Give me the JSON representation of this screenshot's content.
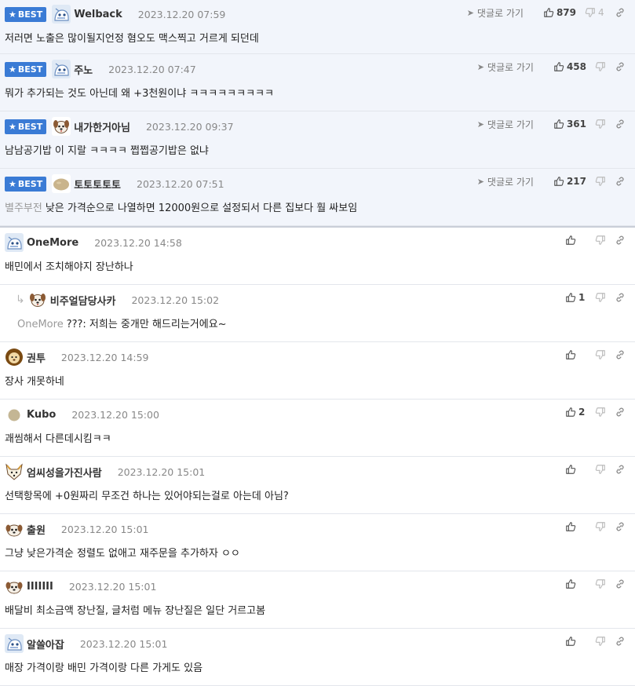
{
  "colors": {
    "best_badge": "#3a7bd5",
    "best_bg": "#f2f5fb",
    "border": "#e3e6ec"
  },
  "labels": {
    "best": "BEST",
    "goto": "댓글로 가기"
  },
  "best_comments": [
    {
      "author": "Welback",
      "time": "2023.12.20 07:59",
      "text": "저러면 노출은 많이될지언정 혐오도 맥스찍고 거르게 되던데",
      "likes": "879",
      "dislikes": "4",
      "avatar": "robot-avatar"
    },
    {
      "author": "주노",
      "time": "2023.12.20 07:47",
      "text": "뭐가 추가되는 것도 아닌데 왜 +3천원이냐 ㅋㅋㅋㅋㅋㅋㅋㅋㅋ",
      "likes": "458",
      "dislikes": "",
      "avatar": "robot-avatar"
    },
    {
      "author": "내가한거아님",
      "time": "2023.12.20 09:37",
      "text": "남남공기밥 이 지랄 ㅋㅋㅋㅋ 쩝쩝공기밥은 없냐",
      "likes": "361",
      "dislikes": "",
      "avatar": "dog-avatar"
    },
    {
      "author": "토토토토토",
      "time": "2023.12.20 07:51",
      "text": "낮은 가격순으로 나열하면 12000원으로 설정되서 다른 집보다 훨 싸보임",
      "mention": "별주부전",
      "likes": "217",
      "dislikes": "",
      "avatar": "potato-avatar"
    }
  ],
  "comments": [
    {
      "author": "OneMore",
      "time": "2023.12.20 14:58",
      "text": "배민에서 조치해야지 장난하나",
      "likes": "",
      "avatar": "robot-avatar",
      "reply": false
    },
    {
      "author": "비주얼담당사카",
      "time": "2023.12.20 15:02",
      "text": "???: 저희는 중개만 해드리는거에요~",
      "mention": "OneMore",
      "likes": "1",
      "avatar": "dog-avatar",
      "reply": true
    },
    {
      "author": "권투",
      "time": "2023.12.20 14:59",
      "text": "장사 개못하네",
      "likes": "",
      "avatar": "lion-avatar",
      "reply": false
    },
    {
      "author": "Kubo",
      "time": "2023.12.20 15:00",
      "text": "괘씸해서 다른데시킴ㅋㅋ",
      "likes": "2",
      "avatar": "dot-avatar",
      "reply": false
    },
    {
      "author": "엄씨성을가진사람",
      "time": "2023.12.20 15:01",
      "text": "선택항목에 +0원짜리 무조건 하나는 있어야되는걸로 아는데 아님?",
      "likes": "",
      "avatar": "fox-avatar",
      "reply": false
    },
    {
      "author": "출원",
      "time": "2023.12.20 15:01",
      "text": "그냥 낮은가격순 정렬도 없애고 재주문을 추가하자 ㅇㅇ",
      "likes": "",
      "avatar": "puppy-avatar",
      "reply": false
    },
    {
      "author": "IIIIIII",
      "time": "2023.12.20 15:01",
      "text": "배달비 최소금액 장난질, 글처럼 메뉴 장난질은 일단 거르고봄",
      "likes": "",
      "avatar": "puppy-avatar",
      "reply": false
    },
    {
      "author": "알쓸아잡",
      "time": "2023.12.20 15:01",
      "text": "매장 가격이랑 배민 가격이랑 다른 가게도 있음",
      "likes": "",
      "avatar": "robot-avatar",
      "reply": false
    }
  ]
}
